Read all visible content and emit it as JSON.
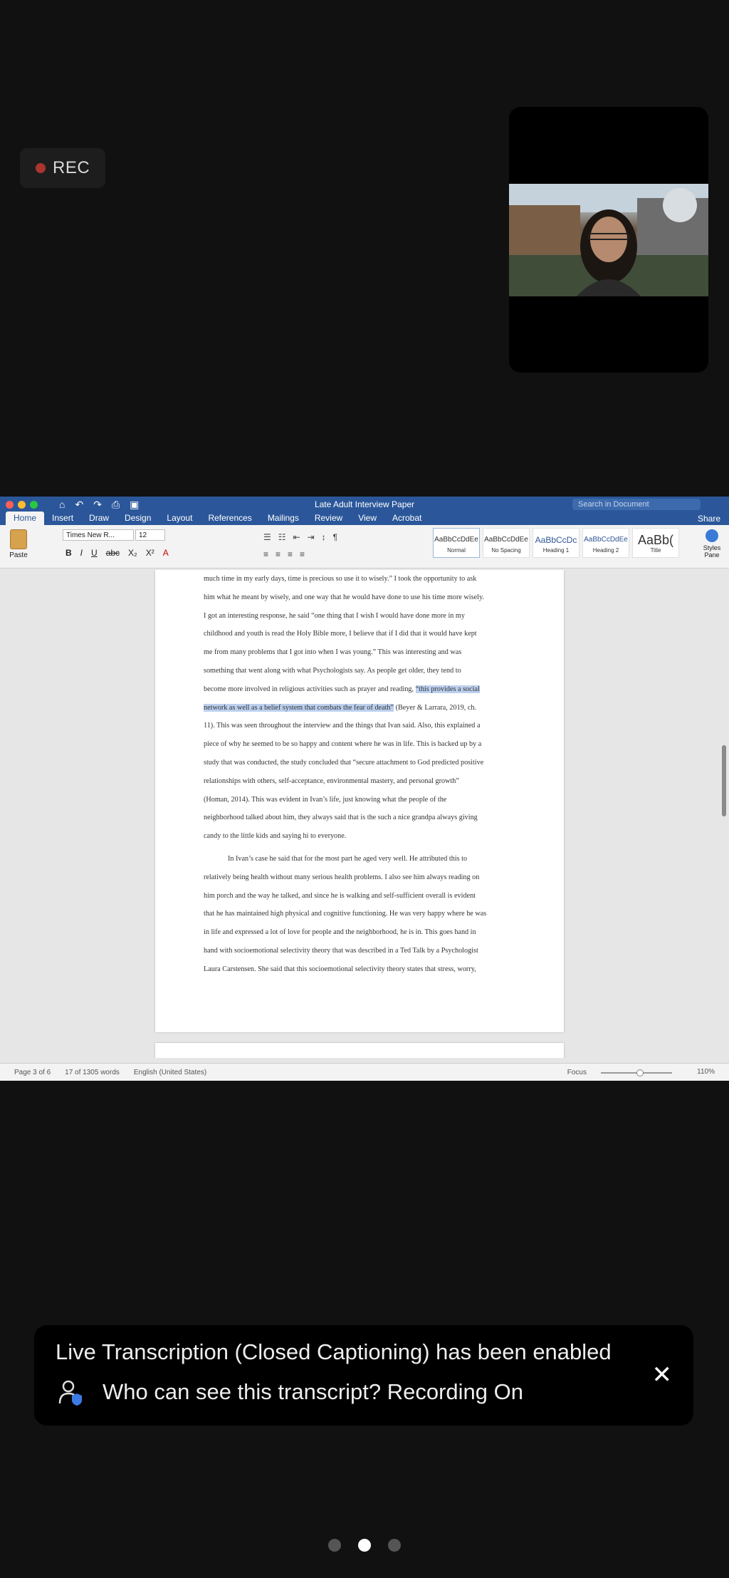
{
  "rec": {
    "label": "REC"
  },
  "word": {
    "title": "Late Adult Interview Paper",
    "search_placeholder": "Search in Document",
    "share": "Share",
    "tabs": [
      "Home",
      "Insert",
      "Draw",
      "Design",
      "Layout",
      "References",
      "Mailings",
      "Review",
      "View",
      "Acrobat"
    ],
    "paste": "Paste",
    "font": "Times New R...",
    "size": "12",
    "styles": [
      {
        "preview": "AaBbCcDdEe",
        "name": "Normal"
      },
      {
        "preview": "AaBbCcDdEe",
        "name": "No Spacing"
      },
      {
        "preview": "AaBbCcDc",
        "name": "Heading 1"
      },
      {
        "preview": "AaBbCcDdEe",
        "name": "Heading 2"
      },
      {
        "preview": "AaBb(",
        "name": "Title"
      }
    ],
    "styles_pane": "Styles Pane",
    "lines": [
      "much time in my early days, time is precious so use it to wisely.” I took the opportunity to ask",
      "him what he meant by wisely, and one way that he would have done to use his time more wisely.",
      "I got an interesting response, he said “one thing that I wish I would have done more in my",
      "childhood and youth is read the Holy Bible more, I believe that if I did that it would have kept",
      "me from many problems that I got into when I was young.” This was interesting and was",
      "something that went along with what Psychologists say. As people get older, they tend to",
      "network as well as a belief system that combats the fear of death”",
      "11). This was seen throughout the interview and the things that Ivan said. Also, this explained a",
      "piece of why he seemed to be so happy and content where he was in life. This is backed up by a",
      "study that was conducted, the study concluded that “secure attachment to God predicted positive",
      "relationships with others, self-acceptance, environmental mastery, and personal growth”",
      "(Homan, 2014). This was evident in Ivan’s life, just knowing what the people of the",
      "neighborhood talked about him, they always said that is the such a nice grandpa always giving",
      "candy to the little kids and saying hi to everyone.",
      "In Ivan’s case he said that for the most part he aged very well. He attributed this to",
      "relatively being health without many serious health problems. I also see him always reading on",
      "him porch and the way he talked, and since he is walking and self-sufficient overall is evident",
      "that he has maintained high physical and cognitive functioning. He was very happy where he was",
      "in life and expressed a lot of love for people and the neighborhood, he is in. This goes hand in",
      "hand with socioemotional selectivity theory that was described in a Ted Talk by a Psychologist",
      "Laura Carstensen. She said that this socioemotional selectivity theory states that stress, worry,"
    ],
    "line6_pre": "become more involved in religious activities such as prayer and reading, ",
    "line6_hl": "“this provides a social",
    "line7_post": " (Beyer & Larrara, 2019, ch.",
    "status": {
      "page": "Page 3 of 6",
      "words": "17 of 1305 words",
      "lang": "English (United States)",
      "focus": "Focus",
      "zoom": "110%"
    }
  },
  "banner": {
    "line1": "Live Transcription (Closed Captioning) has been enabled",
    "line2": "Who can see this transcript? Recording On",
    "close": "✕"
  },
  "colors": {
    "word_blue": "#2b579a",
    "rec_dot": "#a9352f",
    "banner_bg": "#000000"
  }
}
